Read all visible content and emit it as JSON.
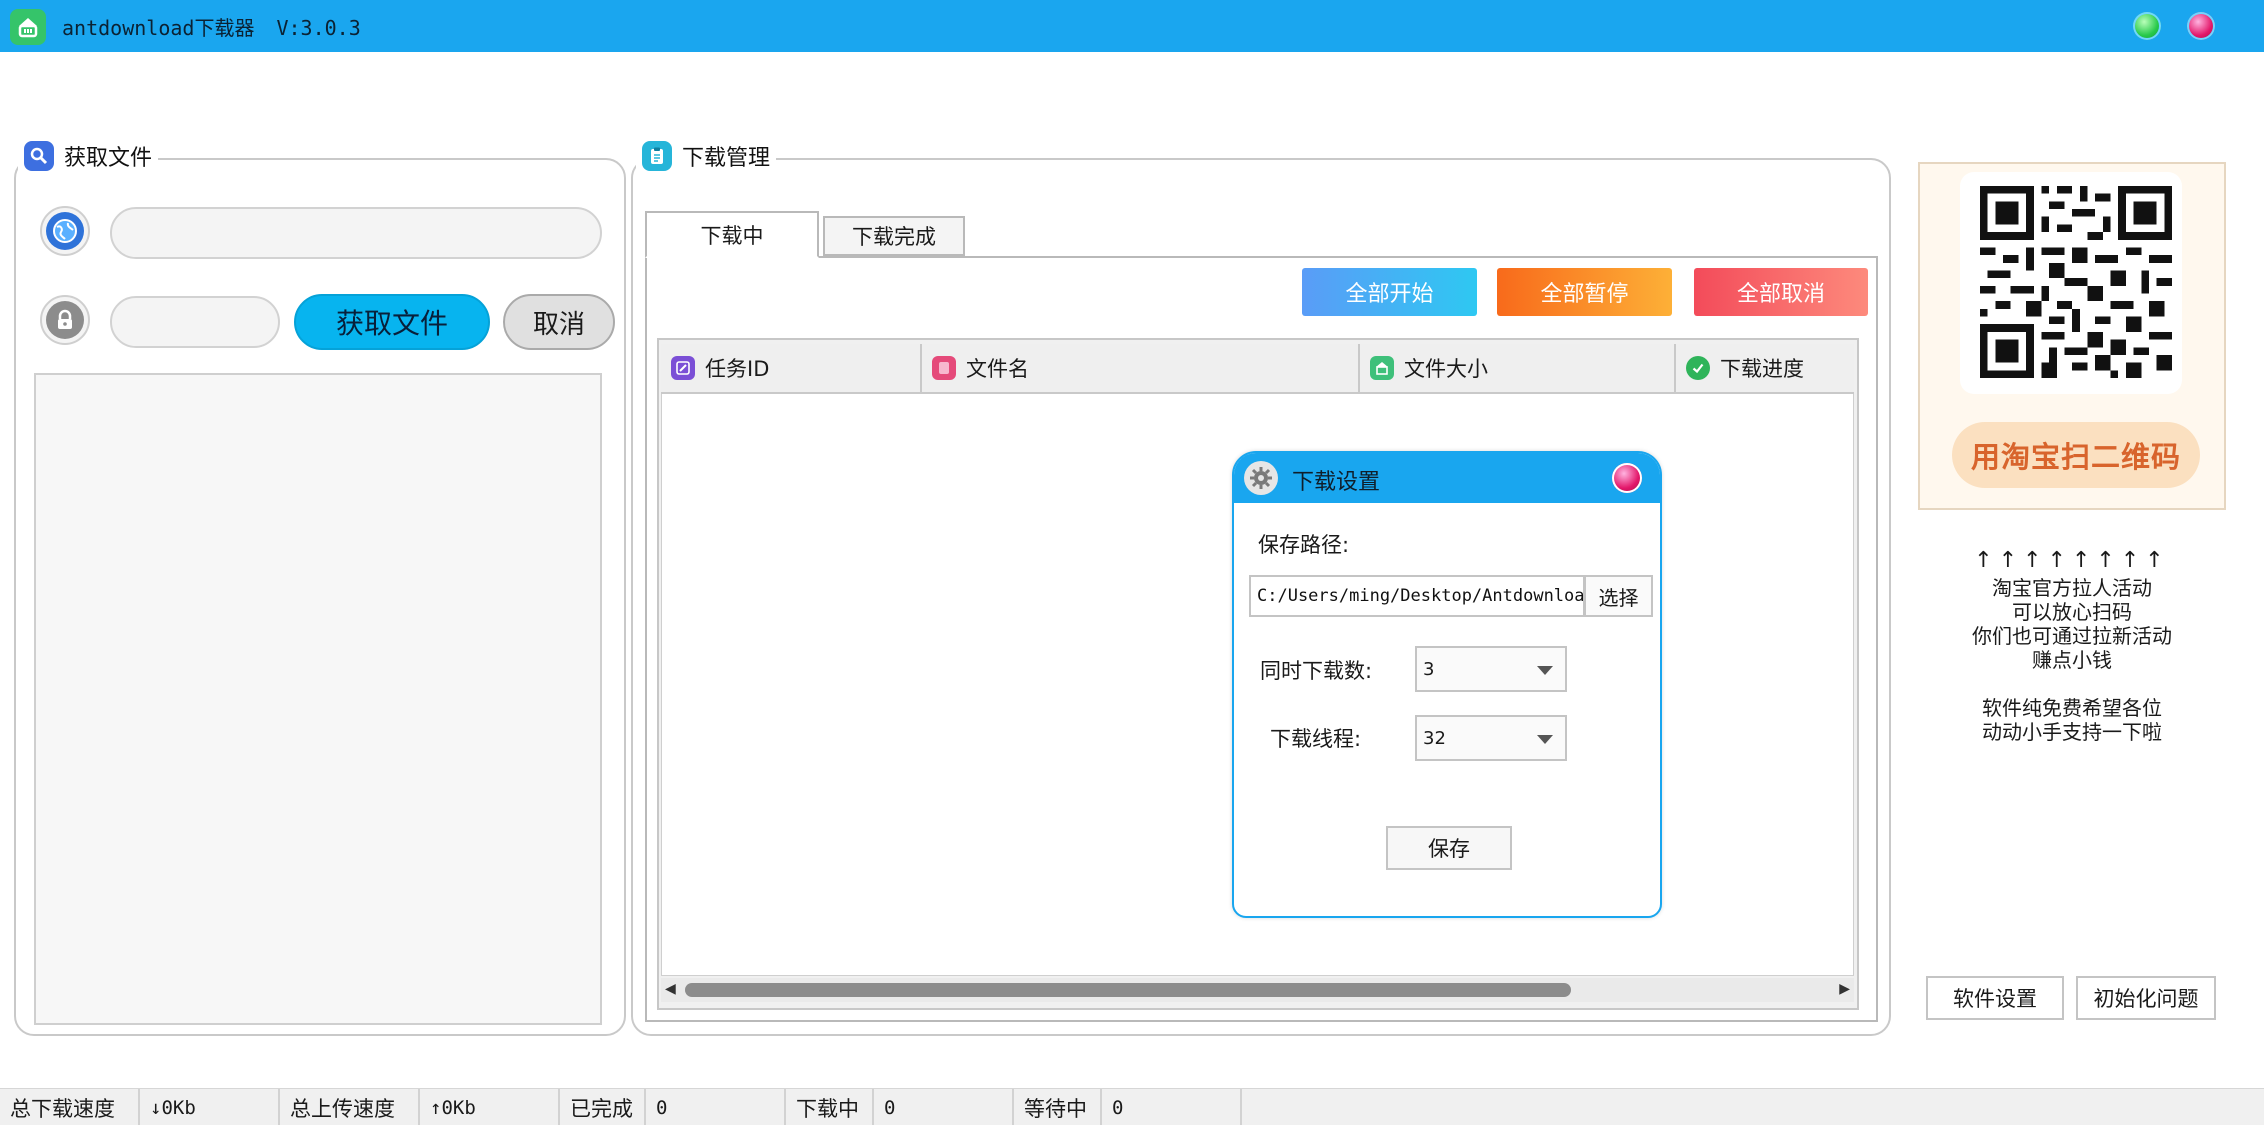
{
  "window": {
    "title": "antdownload下载器",
    "version": "V:3.0.3"
  },
  "fetch_panel": {
    "legend": "获取文件",
    "url_value": "",
    "code_value": "",
    "fetch_button": "获取文件",
    "cancel_button": "取消"
  },
  "download_panel": {
    "legend": "下载管理",
    "tabs": [
      {
        "label": "下载中",
        "active": true
      },
      {
        "label": "下载完成",
        "active": false
      }
    ],
    "actions": {
      "start_all": "全部开始",
      "pause_all": "全部暂停",
      "cancel_all": "全部取消"
    },
    "columns": [
      "任务ID",
      "文件名",
      "文件大小",
      "下载进度"
    ],
    "rows": []
  },
  "settings_dialog": {
    "title": "下载设置",
    "save_path_label": "保存路径:",
    "save_path_value": "C:/Users/ming/Desktop/Antdownload",
    "choose_button": "选择",
    "concurrent_label": "同时下载数:",
    "concurrent_value": "3",
    "threads_label": "下载线程:",
    "threads_value": "32",
    "save_button": "保存"
  },
  "promo": {
    "qr_caption": "用淘宝扫二维码",
    "arrows": "↑↑↑↑↑↑↑↑",
    "lines": [
      "淘宝官方拉人活动",
      "可以放心扫码",
      "你们也可通过拉新活动",
      "赚点小钱"
    ],
    "lines2": [
      "软件纯免费希望各位",
      "动动小手支持一下啦"
    ]
  },
  "side_buttons": {
    "settings": "软件设置",
    "init_issue": "初始化问题"
  },
  "statusbar": {
    "total_download_label": "总下载速度",
    "total_download_value": "↓0Kb",
    "total_upload_label": "总上传速度",
    "total_upload_value": "↑0Kb",
    "completed_label": "已完成",
    "completed_value": "0",
    "downloading_label": "下载中",
    "downloading_value": "0",
    "waiting_label": "等待中",
    "waiting_value": "0"
  },
  "colors": {
    "titlebar": "#1aa6ef",
    "fetch_button": "#07b4ef",
    "accent": "#19a6ef"
  }
}
